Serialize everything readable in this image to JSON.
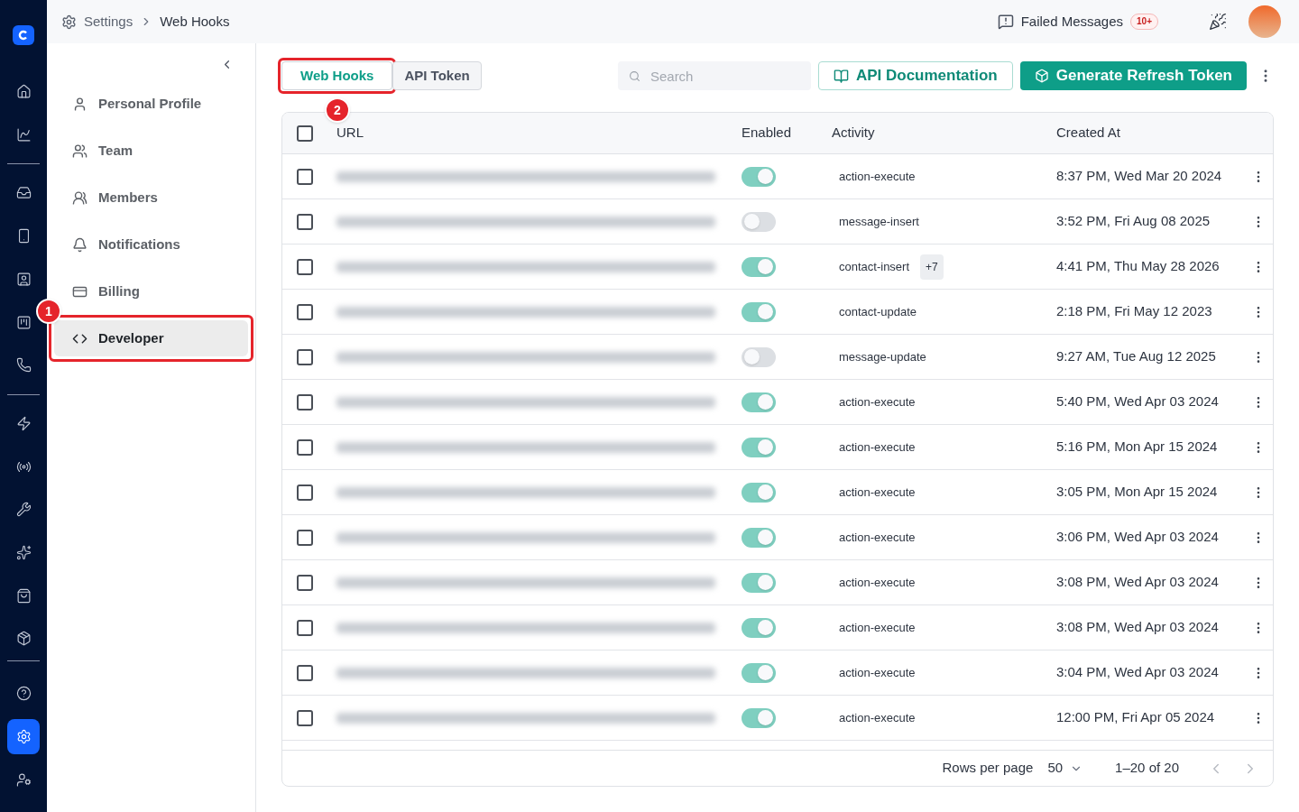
{
  "breadcrumb": [
    "Settings",
    "Web Hooks"
  ],
  "header": {
    "failed_label": "Failed Messages",
    "failed_count": "10+"
  },
  "rail": [
    {
      "selected": false
    },
    {
      "selected": false
    },
    {
      "selected": false
    },
    {
      "selected": false
    },
    {
      "selected": false
    },
    {
      "selected": false
    },
    {
      "selected": false
    },
    {
      "selected": false
    },
    {
      "selected": false
    },
    {
      "selected": false
    },
    {
      "selected": false
    },
    {
      "selected": false
    },
    {
      "selected": false
    }
  ],
  "rail_bottom": [
    {
      "selected": false
    },
    {
      "selected": true
    },
    {
      "selected": false
    }
  ],
  "settings_menu": [
    {
      "label": "Personal Profile",
      "selected": false
    },
    {
      "label": "Team",
      "selected": false
    },
    {
      "label": "Members",
      "selected": false
    },
    {
      "label": "Notifications",
      "selected": false
    },
    {
      "label": "Billing",
      "selected": false
    },
    {
      "label": "Developer",
      "selected": true,
      "callout": "1"
    }
  ],
  "tabs": [
    {
      "label": "Web Hooks",
      "selected": true,
      "callout": "2"
    },
    {
      "label": "API Token",
      "selected": false
    }
  ],
  "search": {
    "placeholder": "Search"
  },
  "buttons": {
    "docs": "API Documentation",
    "generate": "Generate Refresh Token"
  },
  "table": {
    "header_checked": false,
    "columns": [
      "URL",
      "Enabled",
      "Activity",
      "Created At"
    ],
    "rows": [
      {
        "checked": false,
        "on": true,
        "activity": "action-execute",
        "created": "8:37 PM, Wed Mar 20 2024"
      },
      {
        "checked": false,
        "on": false,
        "activity": "message-insert",
        "created": "3:52 PM, Fri Aug 08 2025"
      },
      {
        "checked": false,
        "on": true,
        "activity": "contact-insert",
        "extra": "+7",
        "created": "4:41 PM, Thu May 28 2026"
      },
      {
        "checked": false,
        "on": true,
        "activity": "contact-update",
        "created": "2:18 PM, Fri May 12 2023"
      },
      {
        "checked": false,
        "on": false,
        "activity": "message-update",
        "created": "9:27 AM, Tue Aug 12 2025"
      },
      {
        "checked": false,
        "on": true,
        "activity": "action-execute",
        "created": "5:40 PM, Wed Apr 03 2024"
      },
      {
        "checked": false,
        "on": true,
        "activity": "action-execute",
        "created": "5:16 PM, Mon Apr 15 2024"
      },
      {
        "checked": false,
        "on": true,
        "activity": "action-execute",
        "created": "3:05 PM, Mon Apr 15 2024"
      },
      {
        "checked": false,
        "on": true,
        "activity": "action-execute",
        "created": "3:06 PM, Wed Apr 03 2024"
      },
      {
        "checked": false,
        "on": true,
        "activity": "action-execute",
        "created": "3:08 PM, Wed Apr 03 2024"
      },
      {
        "checked": false,
        "on": true,
        "activity": "action-execute",
        "created": "3:08 PM, Wed Apr 03 2024"
      },
      {
        "checked": false,
        "on": true,
        "activity": "action-execute",
        "created": "3:04 PM, Wed Apr 03 2024"
      },
      {
        "checked": false,
        "on": true,
        "activity": "action-execute",
        "created": "12:00 PM, Fri Apr 05 2024"
      }
    ]
  },
  "pagination": {
    "rows_label": "Rows per page",
    "rows_value": "50",
    "range": "1–20 of 20"
  }
}
